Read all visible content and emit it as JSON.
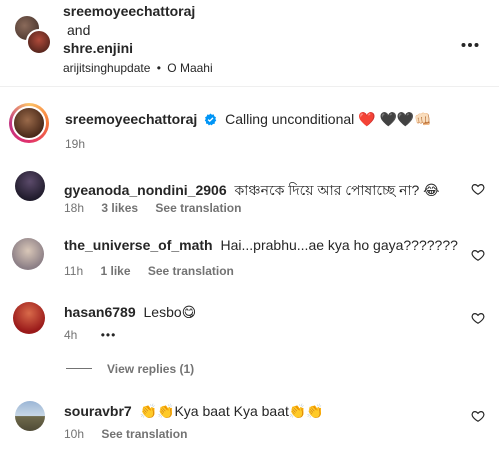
{
  "header": {
    "user1": "sreemoyeechattoraj",
    "connector": "and",
    "user2": "shre.enjini",
    "audio_user": "arijitsinghupdate",
    "audio_sep": "•",
    "audio_track": "O Maahi",
    "more_icon": "more-horizontal-icon"
  },
  "caption": {
    "username": "sreemoyeechattoraj",
    "text": "Calling unconditional ❤️",
    "emoji_tail": "🖤🖤👊🏻",
    "time": "19h"
  },
  "comments": [
    {
      "username": "gyeanoda_nondini_2906",
      "text": "কাঞ্চনকে দিয়ে আর পোষাচ্ছে না? 😂",
      "time": "18h",
      "likes": "3 likes",
      "translate": "See translation"
    },
    {
      "username": "the_universe_of_math",
      "text": "Hai...prabhu...ae kya ho gaya???????",
      "time": "11h",
      "likes": "1 like",
      "translate": "See translation"
    },
    {
      "username": "hasan6789",
      "text": "Lesbo😋",
      "time": "4h",
      "dots": "•••"
    },
    {
      "username": "souravbr7",
      "text": "👏👏Kya baat Kya baat👏👏",
      "time": "10h",
      "translate": "See translation"
    }
  ],
  "view_replies": "View replies (1)",
  "colors": {
    "text": "#262626",
    "muted": "#737373",
    "verified": "#0095f6",
    "story_ring_start": "#fdc468",
    "story_ring_end": "#c13584"
  }
}
